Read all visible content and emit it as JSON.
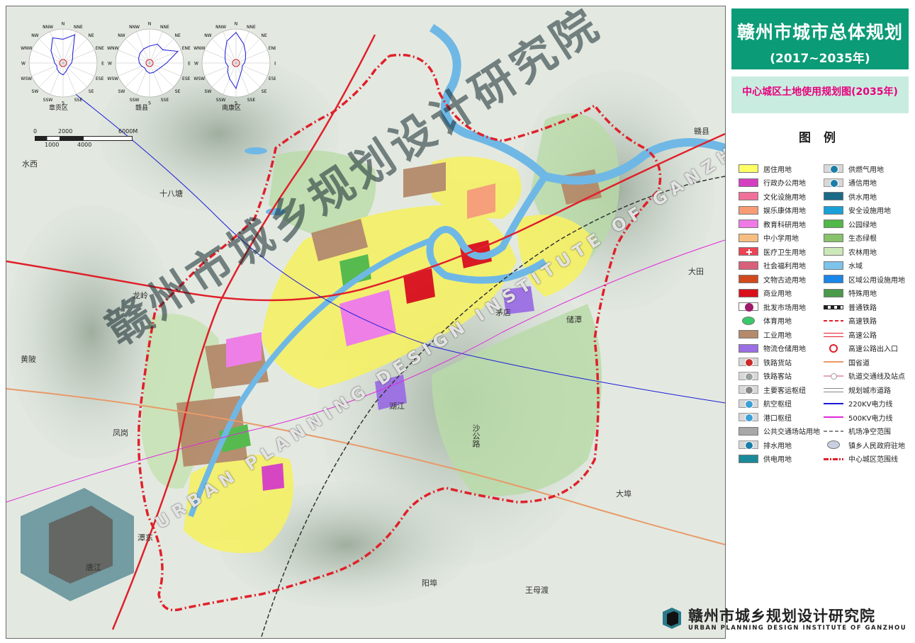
{
  "title": {
    "main": "赣州市城市总体规划",
    "years": "(2017~2035年)",
    "subtitle": "中心城区土地使用规划图(2035年)"
  },
  "legend": {
    "heading": "图 例",
    "left": [
      {
        "label": "居住用地",
        "color": "#ffff66",
        "kind": "fill"
      },
      {
        "label": "行政办公用地",
        "color": "#d63ec2",
        "kind": "fill"
      },
      {
        "label": "文化设施用地",
        "color": "#f0709a",
        "kind": "fill"
      },
      {
        "label": "娱乐康体用地",
        "color": "#f79c76",
        "kind": "fill"
      },
      {
        "label": "教育科研用地",
        "color": "#ef7ae7",
        "kind": "fill"
      },
      {
        "label": "中小学用地",
        "color": "#f7be82",
        "kind": "fill"
      },
      {
        "label": "医疗卫生用地",
        "color": "#ea4455",
        "kind": "symbol-cross"
      },
      {
        "label": "社会福利用地",
        "color": "#d8607a",
        "kind": "fill"
      },
      {
        "label": "文物古迹用地",
        "color": "#d04a1e",
        "kind": "fill"
      },
      {
        "label": "商业用地",
        "color": "#d90f1a",
        "kind": "fill"
      },
      {
        "label": "批发市场用地",
        "color": "#9e1a6a",
        "kind": "symbol-m"
      },
      {
        "label": "体育用地",
        "color": "#38c96a",
        "kind": "symbol-oval"
      },
      {
        "label": "工业用地",
        "color": "#b48a6a",
        "kind": "fill"
      },
      {
        "label": "物流仓储用地",
        "color": "#9b6ee4",
        "kind": "fill"
      },
      {
        "label": "铁路货站",
        "color": "#cc2a2a",
        "kind": "symbol-circle"
      },
      {
        "label": "铁路客站",
        "color": "#9aa0a0",
        "kind": "symbol-circle"
      },
      {
        "label": "主要客运枢纽",
        "color": "#888888",
        "kind": "symbol-circle"
      },
      {
        "label": "航空枢纽",
        "color": "#3aa0d8",
        "kind": "symbol-circle"
      },
      {
        "label": "港口枢纽",
        "color": "#3aa0d8",
        "kind": "symbol-circle"
      },
      {
        "label": "公共交通场站用地",
        "color": "#a8a8a8",
        "kind": "fill"
      },
      {
        "label": "排水用地",
        "color": "#1a7fa8",
        "kind": "symbol-circle"
      },
      {
        "label": "供电用地",
        "color": "#1a8a9a",
        "kind": "fill"
      }
    ],
    "right": [
      {
        "label": "供燃气用地",
        "color": "#1a7fa8",
        "kind": "symbol-circle"
      },
      {
        "label": "通信用地",
        "color": "#1a7fa8",
        "kind": "symbol-circle"
      },
      {
        "label": "供水用地",
        "color": "#1a6a88",
        "kind": "fill"
      },
      {
        "label": "安全设施用地",
        "color": "#1aa0d8",
        "kind": "fill"
      },
      {
        "label": "公园绿地",
        "color": "#4fb848",
        "kind": "fill"
      },
      {
        "label": "生态绿根",
        "color": "#88c26a",
        "kind": "fill"
      },
      {
        "label": "农林用地",
        "color": "#cde8b8",
        "kind": "fill"
      },
      {
        "label": "水域",
        "color": "#7ec3ec",
        "kind": "fill"
      },
      {
        "label": "区域公用设施用地",
        "color": "#1a86e8",
        "kind": "fill"
      },
      {
        "label": "特殊用地",
        "color": "#4a9a4a",
        "kind": "fill"
      },
      {
        "label": "普通铁路",
        "color": "#222222",
        "kind": "line-rail"
      },
      {
        "label": "高速铁路",
        "color": "#e0202a",
        "kind": "line-dash"
      },
      {
        "label": "高速公路",
        "color": "#e0202a",
        "kind": "line-double"
      },
      {
        "label": "高速公路出入口",
        "color": "#e0202a",
        "kind": "symbol-ring"
      },
      {
        "label": "国省道",
        "color": "#e89a6a",
        "kind": "line"
      },
      {
        "label": "轨道交通线及站点",
        "color": "#e8a0c0",
        "kind": "line-station"
      },
      {
        "label": "规划城市道路",
        "color": "#888888",
        "kind": "line-double"
      },
      {
        "label": "220KV电力线",
        "color": "#1a1ad8",
        "kind": "line"
      },
      {
        "label": "500KV电力线",
        "color": "#e02ad8",
        "kind": "line"
      },
      {
        "label": "机场净空范围",
        "color": "#888888",
        "kind": "line-dash"
      },
      {
        "label": "镇乡人民政府驻地",
        "color": "#c8d0e0",
        "kind": "symbol-oval"
      },
      {
        "label": "中心城区范围线",
        "color": "#e0202a",
        "kind": "line-dashdot"
      }
    ]
  },
  "wind_roses": [
    {
      "caption": "章贡区"
    },
    {
      "caption": "赣县"
    },
    {
      "caption": "南康区"
    }
  ],
  "rose_directions": [
    "N",
    "NNE",
    "NE",
    "ENE",
    "E",
    "ESE",
    "SE",
    "SSE",
    "S",
    "SSW",
    "SW",
    "WSW",
    "W",
    "WNW",
    "NW",
    "NNW"
  ],
  "scale_bar": {
    "ticks_top": [
      "0",
      "2000",
      "6000M"
    ],
    "ticks_bottom": [
      "1000",
      "4000"
    ]
  },
  "places": [
    {
      "name": "赣县"
    },
    {
      "name": "大田"
    },
    {
      "name": "大埠"
    },
    {
      "name": "阳埠"
    },
    {
      "name": "王母渡"
    },
    {
      "name": "龙岭"
    },
    {
      "name": "潭东"
    },
    {
      "name": "十八塘"
    },
    {
      "name": "唐江"
    },
    {
      "name": "黄陂"
    },
    {
      "name": "水西"
    },
    {
      "name": "凤岗"
    },
    {
      "name": "茅店"
    },
    {
      "name": "储潭"
    },
    {
      "name": "湖江"
    },
    {
      "name": "沙公路"
    }
  ],
  "watermark": {
    "cn": "赣州市城乡规划设计研究院",
    "en": "URBAN PLANNING DESIGN INSTITUTE OF GANZHOU"
  },
  "footer": {
    "cn": "赣州市城乡规划设计研究院",
    "en": "URBAN PLANNING DESIGN INSTITUTE OF GANZHOU"
  }
}
